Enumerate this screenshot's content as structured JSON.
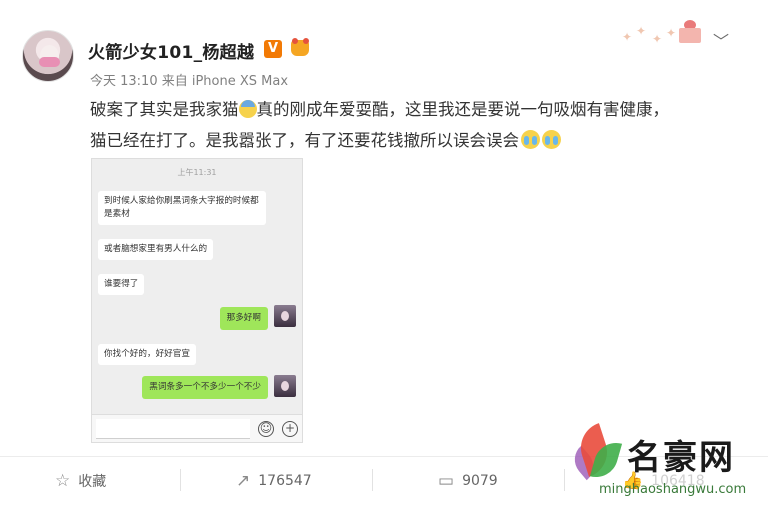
{
  "post": {
    "username": "火箭少女101_杨超越",
    "verified_badge": "V",
    "meta": "今天 13:10 来自 iPhone XS Max",
    "text_line1_a": "破案了其实是我家猫",
    "text_line1_b": "真的刚成年爱耍酷，这里我还是要说一句吸烟有害健康，",
    "text_line2": "猫已经在打了。是我嚣张了，有了还要花钱撤所以误会误会",
    "icons": [
      "avatar",
      "vip-badge",
      "level-badge",
      "decorative-stars",
      "gift-icon",
      "chevron-down-icon",
      "cat-emoji",
      "crying-emoji"
    ]
  },
  "chat": {
    "time": "上午11:31",
    "messages": [
      {
        "side": "left",
        "text": "到时候人家给你刷黑词条大字报的时候都是素材"
      },
      {
        "side": "left",
        "text": "或者脑想家里有男人什么的"
      },
      {
        "side": "left",
        "text": "谁要得了"
      },
      {
        "side": "right",
        "text": "那多好啊"
      },
      {
        "side": "left",
        "text": "你找个好的，好好官宣"
      },
      {
        "side": "right",
        "text": "黑词条多一个不多少一个不少"
      }
    ],
    "emoji_icon": "☺",
    "plus_icon": "+"
  },
  "footer": {
    "favorite_label": "收藏",
    "repost_count": "176547",
    "comment_count": "9079",
    "like_count": "106418"
  },
  "watermark": {
    "title": "名豪网",
    "url": "minghaoshangwu.com"
  },
  "colors": {
    "chat_right_bubble": "#9fe65a",
    "vip_orange": "#f27a05",
    "text_main": "#333333",
    "text_meta": "#808080"
  }
}
